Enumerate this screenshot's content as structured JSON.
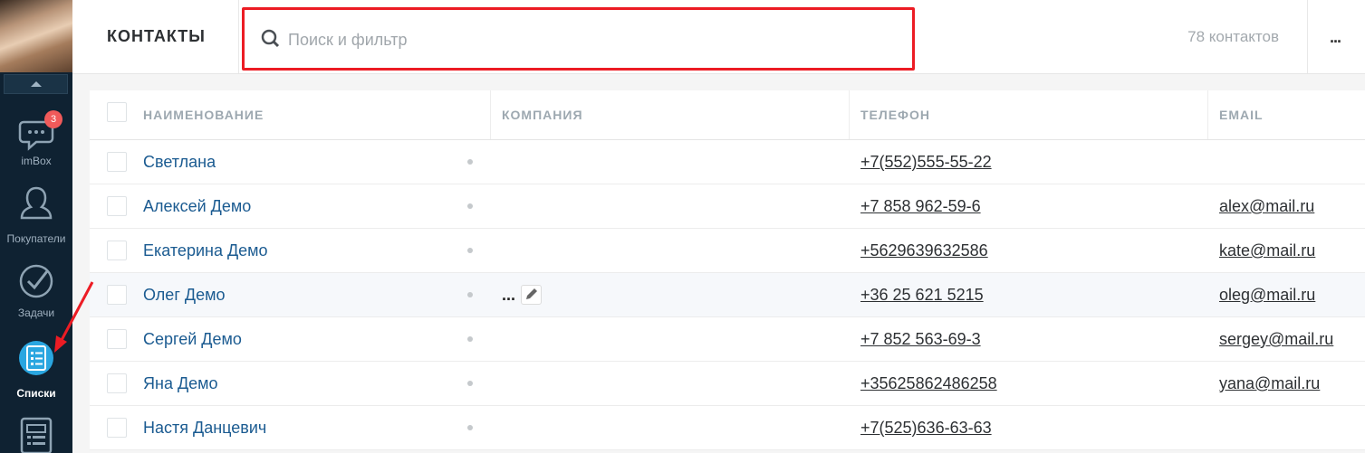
{
  "sidebar": {
    "badge_count": "3",
    "items": [
      {
        "label": "imBox",
        "icon": "chat-icon"
      },
      {
        "label": "Покупатели",
        "icon": "customers-icon"
      },
      {
        "label": "Задачи",
        "icon": "tasks-check-icon"
      },
      {
        "label": "Списки",
        "icon": "lists-icon",
        "active": true
      },
      {
        "label": "",
        "icon": "catalog-icon"
      }
    ]
  },
  "header": {
    "title": "КОНТАКТЫ",
    "search_placeholder": "Поиск и фильтр",
    "count_text": "78 контактов",
    "more_label": "..."
  },
  "table": {
    "columns": [
      "НАИМЕНОВАНИЕ",
      "КОМПАНИЯ",
      "ТЕЛЕФОН",
      "EMAIL"
    ],
    "rows": [
      {
        "name": "Светлана",
        "company": "",
        "phone": "+7(552)555-55-22",
        "email": ""
      },
      {
        "name": "Алексей Демо",
        "company": "",
        "phone": "+7 858 962-59-6",
        "email": "alex@mail.ru"
      },
      {
        "name": "Екатерина Демо",
        "company": "",
        "phone": "+5629639632586",
        "email": "kate@mail.ru"
      },
      {
        "name": "Олег Демо",
        "company": "...",
        "phone": "+36 25 621 5215",
        "email": "oleg@mail.ru"
      },
      {
        "name": "Сергей Демо",
        "company": "",
        "phone": "+7 852 563-69-3",
        "email": "sergey@mail.ru"
      },
      {
        "name": "Яна Демо",
        "company": "",
        "phone": "+35625862486258",
        "email": "yana@mail.ru"
      },
      {
        "name": "Настя Данцевич",
        "company": "",
        "phone": "+7(525)636-63-63",
        "email": ""
      }
    ]
  },
  "colors": {
    "sidebar_bg": "#0f2232",
    "link": "#1b5b91",
    "highlight": "#ec1c24",
    "badge": "#f05a5a",
    "active_icon": "#2aa6e0"
  }
}
